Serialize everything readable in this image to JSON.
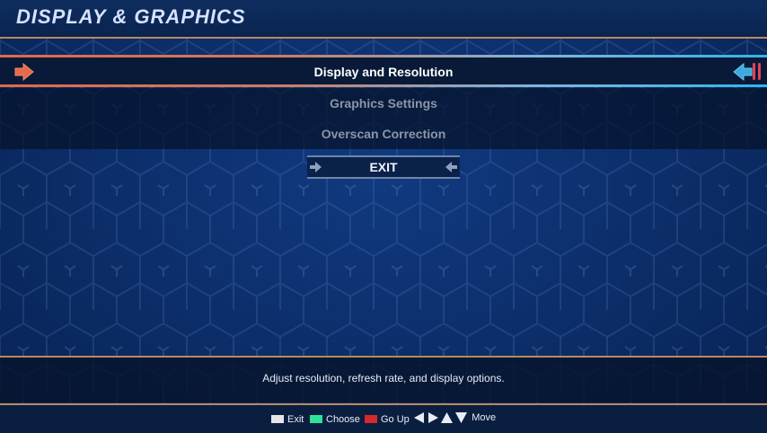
{
  "header": {
    "title": "DISPLAY & GRAPHICS"
  },
  "menu": {
    "items": [
      {
        "label": "Display and Resolution",
        "selected": true
      },
      {
        "label": "Graphics Settings",
        "selected": false
      },
      {
        "label": "Overscan Correction",
        "selected": false
      }
    ],
    "exit_label": "EXIT"
  },
  "description": "Adjust resolution, refresh rate, and display options.",
  "controls": {
    "exit_label": "Exit",
    "choose_label": "Choose",
    "goup_label": "Go Up",
    "move_label": "Move",
    "exit_color": "#e6e6e6",
    "choose_color": "#2fe29a",
    "goup_color": "#d42a2a"
  },
  "colors": {
    "accent_orange": "#e0684a",
    "accent_blue": "#33b4e8",
    "trim": "#b98a5a"
  }
}
